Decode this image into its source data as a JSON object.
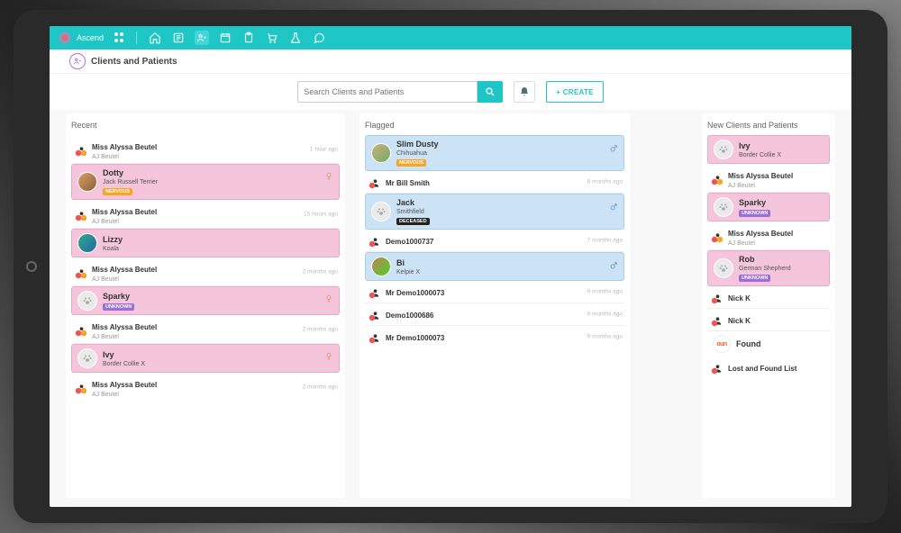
{
  "brand": "Ascend",
  "page_title": "Clients and Patients",
  "search": {
    "placeholder": "Search Clients and Patients"
  },
  "create_button": "+  CREATE",
  "columns": {
    "recent": {
      "title": "Recent"
    },
    "flagged": {
      "title": "Flagged"
    },
    "new": {
      "title": "New Clients and Patients"
    }
  },
  "tags": {
    "nervous": "NERVOUS",
    "deceased": "DECEASED",
    "unknown": "UNKNOWN"
  },
  "recent": [
    {
      "owner": "Miss Alyssa Beutel",
      "owner_sub": "AJ Beutel",
      "time": "1 hour ago"
    },
    {
      "patient": "Dotty",
      "breed": "Jack Russell Terrier",
      "tag": "nervous",
      "sex": "f",
      "avatar": "photo",
      "owner": "Miss Alyssa Beutel",
      "owner_sub": "AJ Beutel",
      "time": "15 hours ago"
    },
    {
      "patient": "Lizzy",
      "breed": "Koala",
      "avatar": "photo2",
      "owner": "Miss Alyssa Beutel",
      "owner_sub": "AJ Beutel",
      "time": "2 months ago"
    },
    {
      "patient": "Sparky",
      "breed": "",
      "tag": "unknown",
      "sex": "f",
      "avatar": "placeholder",
      "owner": "Miss Alyssa Beutel",
      "owner_sub": "AJ Beutel",
      "time": "2 months ago"
    },
    {
      "patient": "Ivy",
      "breed": "Border Collie X",
      "sex": "f",
      "avatar": "placeholder",
      "owner": "Miss Alyssa Beutel",
      "owner_sub": "AJ Beutel",
      "time": "2 months ago"
    }
  ],
  "flagged": [
    {
      "patient": "Slim Dusty",
      "breed": "Chihuahua",
      "tag": "nervous",
      "sex": "m",
      "avatar": "photo3",
      "owner": "Mr Bill Smith",
      "time": "6 months ago"
    },
    {
      "patient": "Jack",
      "breed": "Smithfield",
      "tag": "deceased",
      "sex": "m",
      "avatar": "placeholder",
      "owner": "Demo1000737",
      "time": "7 months ago"
    },
    {
      "patient": "Bi",
      "breed": "Kelpie X",
      "sex": "m",
      "avatar": "photo4",
      "owner": "Mr Demo1000073",
      "time": "9 months ago"
    },
    {
      "owner": "Demo1000686",
      "time": "9 months ago"
    },
    {
      "owner": "Mr Demo1000073",
      "time": "9 months ago"
    }
  ],
  "new": [
    {
      "patient": "Ivy",
      "breed": "Border Collie X",
      "avatar": "placeholder",
      "owner": "Miss Alyssa Beutel",
      "owner_sub": "AJ Beutel"
    },
    {
      "patient": "Sparky",
      "breed": "",
      "tag": "unknown",
      "avatar": "placeholder",
      "owner": "Miss Alyssa Beutel",
      "owner_sub": "AJ Beutel"
    },
    {
      "patient": "Rob",
      "breed": "German Shepherd",
      "tag": "unknown",
      "avatar": "placeholder",
      "owner": "Nick K"
    },
    {
      "owner": "Nick K"
    },
    {
      "patient": "Found",
      "avatar": "found",
      "owner": "Lost and Found List"
    }
  ]
}
